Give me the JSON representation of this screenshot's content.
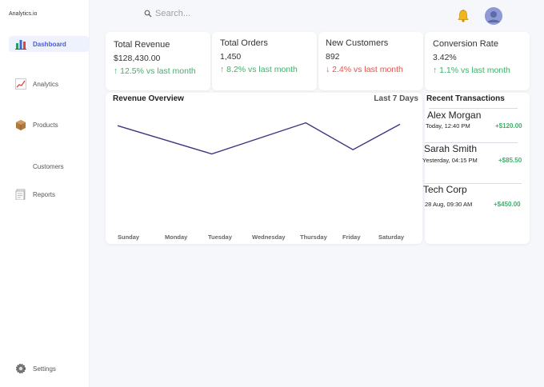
{
  "brand": "Analytics.io",
  "sidebar": {
    "items": [
      {
        "label": "Dashboard",
        "icon": "bar-chart-icon"
      },
      {
        "label": "Analytics",
        "icon": "line-chart-icon"
      },
      {
        "label": "Products",
        "icon": "box-icon"
      },
      {
        "label": "Customers",
        "icon": ""
      },
      {
        "label": "Reports",
        "icon": "document-icon"
      }
    ],
    "settings": {
      "label": "Settings",
      "icon": "gear-icon"
    }
  },
  "topbar": {
    "search_placeholder": "Search...",
    "notifications_icon": "bell-icon",
    "avatar_icon": "user-avatar"
  },
  "stats": [
    {
      "title": "Total Revenue",
      "value": "$128,430.00",
      "trend": "↑ 12.5% vs last month",
      "direction": "up"
    },
    {
      "title": "Total Orders",
      "value": "1,450",
      "trend": "↑ 8.2% vs last month",
      "direction": "up"
    },
    {
      "title": "New Customers",
      "value": "892",
      "trend": "↓ 2.4% vs last month",
      "direction": "down"
    },
    {
      "title": "Conversion Rate",
      "value": "3.42%",
      "trend": "↑ 1.1% vs last month",
      "direction": "up"
    }
  ],
  "revenue": {
    "title": "Revenue Overview",
    "range": "Last 7 Days"
  },
  "chart_data": {
    "type": "line",
    "title": "Revenue Overview",
    "categories": [
      "Sunday",
      "Monday",
      "Tuesday",
      "Wednesday",
      "Thursday",
      "Friday",
      "Saturday"
    ],
    "values": [
      73,
      null,
      53,
      null,
      75,
      56,
      74
    ],
    "ylim": [
      0,
      85
    ],
    "line_color": "#3b3680",
    "grid": false,
    "xlabel": "",
    "ylabel": ""
  },
  "transactions": {
    "title": "Recent Transactions",
    "items": [
      {
        "name": "Alex Morgan",
        "time": "Today, 12:40 PM",
        "amount": "+$120.00"
      },
      {
        "name": "Sarah Smith",
        "time": "Yesterday, 04:15 PM",
        "amount": "+$85.50"
      },
      {
        "name": "Tech Corp",
        "time": "28 Aug, 09:30 AM",
        "amount": "+$450.00"
      }
    ]
  },
  "colors": {
    "accent": "#4a5be0",
    "positive": "#3fb06a",
    "negative": "#e5534b",
    "line": "#3b3680"
  }
}
